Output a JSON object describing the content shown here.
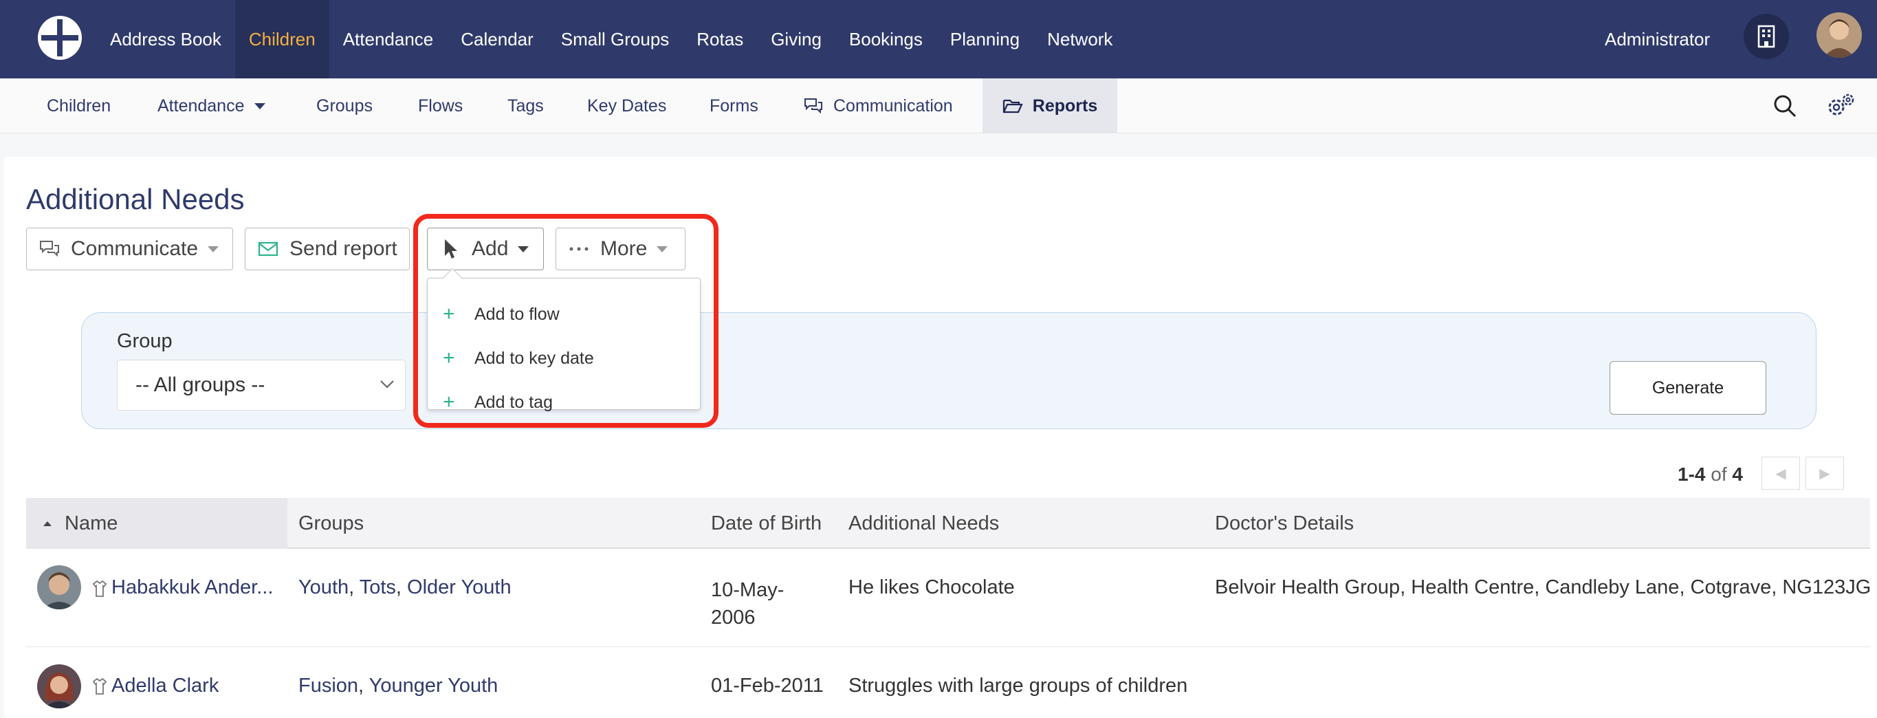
{
  "topnav": {
    "items": [
      "Address Book",
      "Children",
      "Attendance",
      "Calendar",
      "Small Groups",
      "Rotas",
      "Giving",
      "Bookings",
      "Planning",
      "Network"
    ],
    "user": "Administrator"
  },
  "subnav": {
    "children": "Children",
    "attendance": "Attendance",
    "groups": "Groups",
    "flows": "Flows",
    "tags": "Tags",
    "key_dates": "Key Dates",
    "forms": "Forms",
    "communication": "Communication",
    "reports": "Reports"
  },
  "page": {
    "title": "Additional Needs"
  },
  "toolbar": {
    "communicate": "Communicate",
    "send_report": "Send report",
    "add": "Add",
    "more": "More"
  },
  "add_menu": [
    "Add to flow",
    "Add to key date",
    "Add to tag"
  ],
  "filter": {
    "group_label": "Group",
    "group_value": "-- All groups --",
    "generate": "Generate"
  },
  "pager": {
    "range": "1-4",
    "of": "of",
    "total": "4"
  },
  "table": {
    "headers": [
      "Name",
      "Groups",
      "Date of Birth",
      "Additional Needs",
      "Doctor's Details"
    ],
    "rows": [
      {
        "name": "Habakkuk Ander...",
        "groups": [
          "Youth",
          "Tots",
          "Older Youth"
        ],
        "dob_line1": "10-May-",
        "dob_line2": "2006",
        "needs": "He likes Chocolate",
        "doctor": "Belvoir Health Group, Health Centre, Candleby Lane, Cotgrave, NG123JG"
      },
      {
        "name": "Adella Clark",
        "groups": [
          "Fusion",
          "Younger Youth"
        ],
        "dob": "01-Feb-2011",
        "needs": "Struggles with large groups of children",
        "doctor": ""
      }
    ]
  },
  "colors": {
    "nav_bg": "#2f3a6b",
    "active_tab": "#f5b041",
    "highlight": "#f0291c",
    "plus": "#2bb38a"
  }
}
